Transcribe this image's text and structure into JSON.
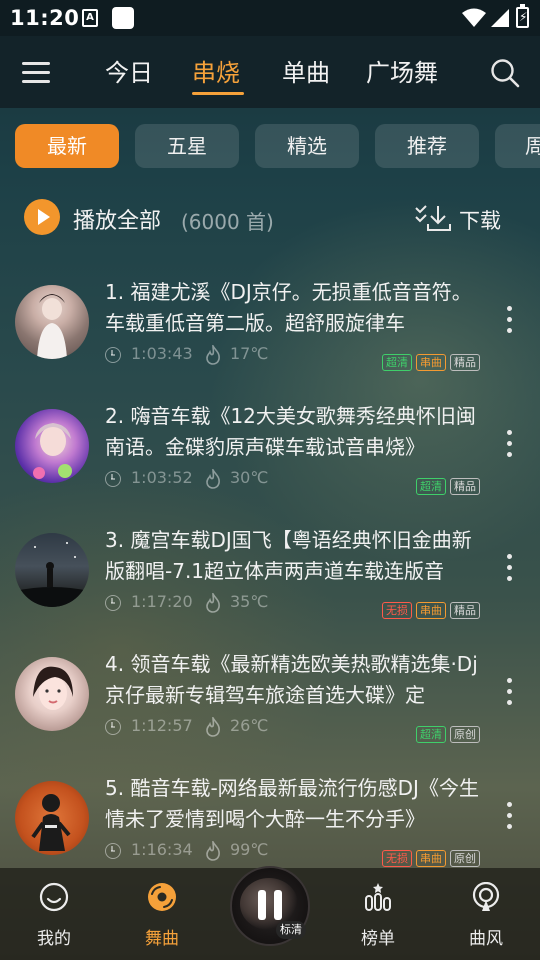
{
  "status_bar": {
    "time": "11:20",
    "badge_letter": "A"
  },
  "header": {
    "tabs": [
      {
        "label": "今日"
      },
      {
        "label": "串烧"
      },
      {
        "label": "单曲"
      },
      {
        "label": "广场舞"
      }
    ],
    "active_tab": "串烧"
  },
  "filters": {
    "chips": [
      "最新",
      "五星",
      "精选",
      "推荐",
      "周"
    ],
    "active": "最新"
  },
  "play_all": {
    "label": "播放全部",
    "count": "(6000 首)",
    "download_label": "下载"
  },
  "songs": [
    {
      "title": "1. 福建尤溪《DJ京仔。无损重低音音符。车载重低音第二版。超舒服旋律车",
      "duration": "1:03:43",
      "heat": "17℃",
      "tags": [
        {
          "text": "超清",
          "color": "green"
        },
        {
          "text": "串曲",
          "color": "orange"
        },
        {
          "text": "精品",
          "color": "gray"
        }
      ]
    },
    {
      "title": "2. 嗨音车载《12大美女歌舞秀经典怀旧闽南语。金碟豹原声碟车载试音串烧》",
      "duration": "1:03:52",
      "heat": "30℃",
      "tags": [
        {
          "text": "超清",
          "color": "green"
        },
        {
          "text": "精品",
          "color": "gray"
        }
      ]
    },
    {
      "title": "3. 魔宫车载DJ国飞【粤语经典怀旧金曲新版翻唱-7.1超立体声两声道车载连版音",
      "duration": "1:17:20",
      "heat": "35℃",
      "tags": [
        {
          "text": "无损",
          "color": "red"
        },
        {
          "text": "串曲",
          "color": "orange"
        },
        {
          "text": "精品",
          "color": "gray"
        }
      ]
    },
    {
      "title": "4. 领音车载《最新精选欧美热歌精选集·Dj京仔最新专辑驾车旅途首选大碟》定",
      "duration": "1:12:57",
      "heat": "26℃",
      "tags": [
        {
          "text": "超清",
          "color": "green"
        },
        {
          "text": "原创",
          "color": "gray"
        }
      ]
    },
    {
      "title": "5. 酷音车载-网络最新最流行伤感DJ《今生情未了爱情到喝个大醉一生不分手》",
      "duration": "1:16:34",
      "heat": "99℃",
      "tags": [
        {
          "text": "无损",
          "color": "red"
        },
        {
          "text": "串曲",
          "color": "orange"
        },
        {
          "text": "原创",
          "color": "gray"
        }
      ]
    }
  ],
  "bottom_nav": {
    "items": [
      {
        "label": "我的",
        "icon": "smiley-icon"
      },
      {
        "label": "舞曲",
        "icon": "disc-icon"
      },
      {
        "label": "榜单",
        "icon": "chart-icon"
      },
      {
        "label": "曲风",
        "icon": "podcast-icon"
      }
    ],
    "active": "舞曲",
    "player_badge": "标清"
  },
  "colors": {
    "accent": "#f5a13a",
    "chip_active": "#f08a26",
    "tag_green": "#3fcf6a",
    "tag_orange": "#f39a32",
    "tag_red": "#ff5a4a"
  }
}
